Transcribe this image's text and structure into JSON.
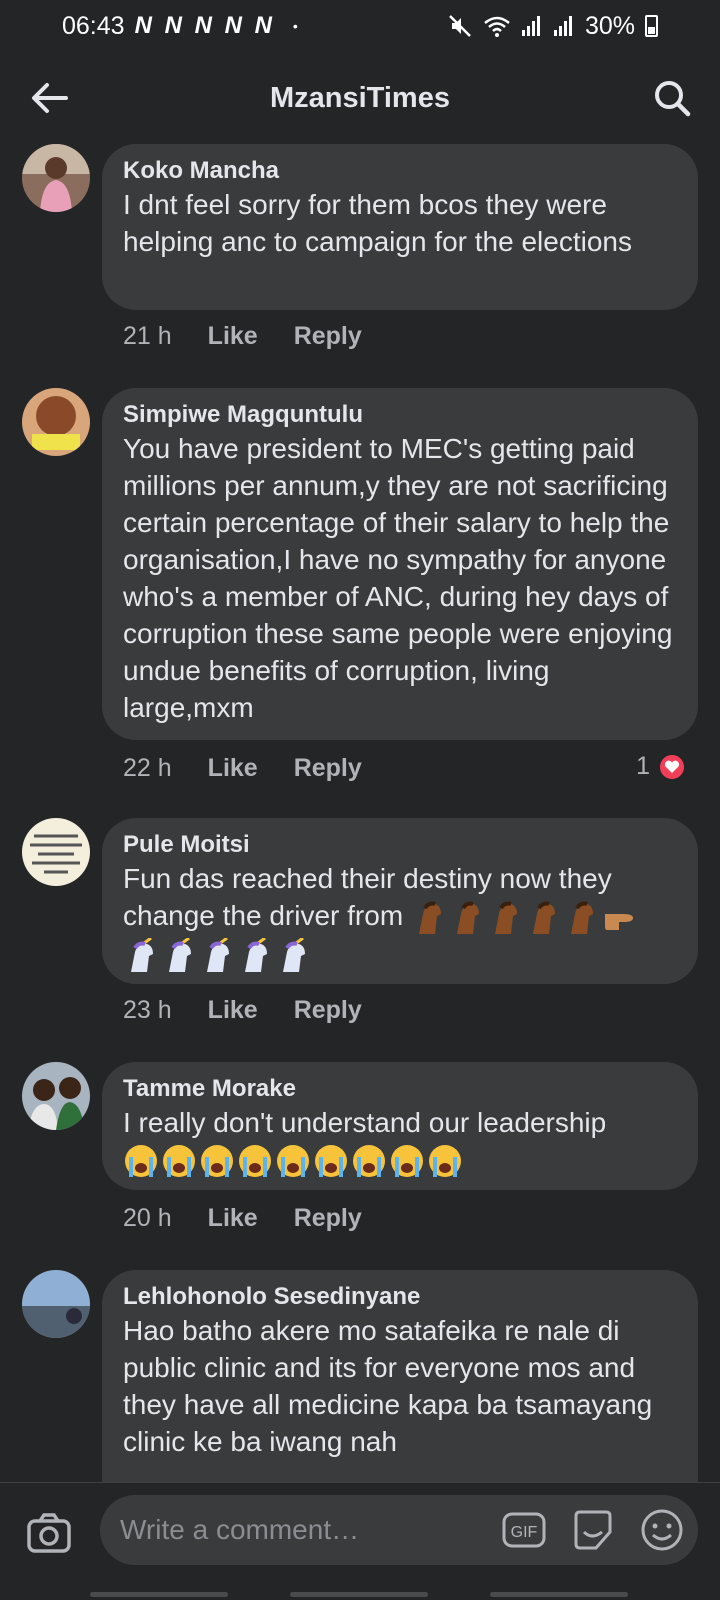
{
  "status_bar": {
    "time": "06:43",
    "notification_icons": "N N N N N",
    "dot": "•",
    "battery": "30%"
  },
  "header": {
    "title": "MzansiTimes"
  },
  "comments": [
    {
      "author": "Koko Mancha",
      "text": "I dnt feel  sorry for them bcos they were helping  anc to campaign  for the elections",
      "time": "21 h",
      "like": "Like",
      "reply": "Reply"
    },
    {
      "author": "Simpiwe Magquntulu",
      "text": "You have president to MEC's getting paid millions per annum,y they are not sacrificing certain percentage of their salary to help the organisation,I have no sympathy for anyone who's a member of ANC, during hey days of corruption these same people were enjoying undue benefits of corruption, living large,mxm",
      "time": "22 h",
      "like": "Like",
      "reply": "Reply",
      "reaction_count": "1",
      "avatar_text": "WE REFUSE TO JOIN THE LOOTING"
    },
    {
      "author": "Pule Moitsi",
      "text": "Fun das reached their destiny now they change the driver from",
      "time": "23 h",
      "like": "Like",
      "reply": "Reply",
      "avatar_text": "IN THE LAST DAYS GOOD WILL BE CALLED EVIL, AND EVIL CALLED GOOD."
    },
    {
      "author": "Tamme Morake",
      "text": "I really don't understand our leadership",
      "time": "20 h",
      "like": "Like",
      "reply": "Reply"
    },
    {
      "author": "Lehlohonolo Sesedinyane",
      "text": "Hao batho akere mo satafeika re nale di public clinic and its for everyone mos and they have all medicine kapa ba tsamayang clinic ke ba iwang nah"
    }
  ],
  "composer": {
    "placeholder": "Write a comment…",
    "gif_label": "GIF"
  },
  "colors": {
    "background": "#242526",
    "bubble": "#3a3b3c",
    "text": "#e4e6eb",
    "meta": "#b0b3b8",
    "heart": "#f33e58"
  },
  "icons": [
    "back-arrow-icon",
    "search-icon",
    "camera-icon",
    "gif-icon",
    "sticker-icon",
    "emoji-icon",
    "heart-icon"
  ]
}
